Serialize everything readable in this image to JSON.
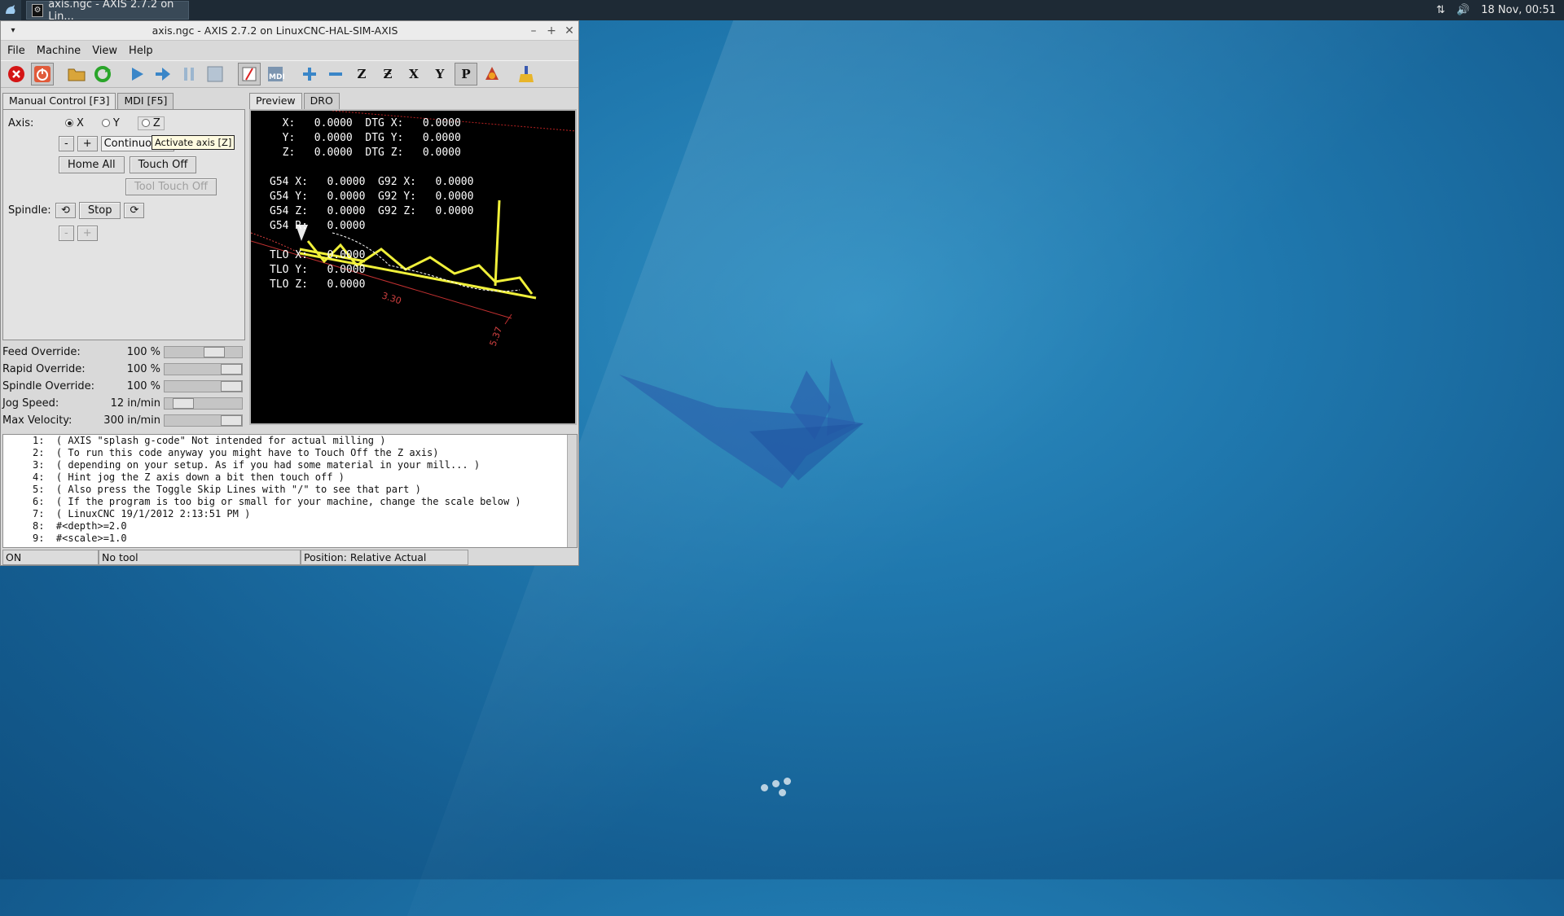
{
  "taskbar": {
    "task_title": "axis.ngc - AXIS 2.7.2 on Lin...",
    "clock": "18 Nov, 00:51"
  },
  "window": {
    "title": "axis.ngc - AXIS 2.7.2 on LinuxCNC-HAL-SIM-AXIS",
    "menu": [
      "File",
      "Machine",
      "View",
      "Help"
    ]
  },
  "toolbar_icons": [
    "estop-icon",
    "power-icon",
    "open-icon",
    "reload-icon",
    "run-icon",
    "step-icon",
    "pause-icon",
    "stop-icon",
    "skip-lines-icon",
    "mdi-icon",
    "zoom-in-icon",
    "zoom-out-icon",
    "view-z-icon",
    "view-z2-icon",
    "view-x-icon",
    "view-y-icon",
    "view-p-icon",
    "rotate-icon",
    "clear-live-plot-icon"
  ],
  "manual": {
    "tab_manual": "Manual Control [F3]",
    "tab_mdi": "MDI [F5]",
    "axis_label": "Axis:",
    "axis_x": "X",
    "axis_y": "Y",
    "axis_z": "Z",
    "minus": "-",
    "plus": "+",
    "jog_mode": "Continuous",
    "tooltip": "Activate axis [Z]",
    "home_all": "Home All",
    "touch_off": "Touch Off",
    "tool_touch_off": "Tool Touch Off",
    "spindle_label": "Spindle:",
    "spindle_stop": "Stop",
    "spindle_minus": "-",
    "spindle_plus": "+"
  },
  "overrides": [
    {
      "name": "Feed Override:",
      "value": "100 %",
      "fraction": 0.7
    },
    {
      "name": "Rapid Override:",
      "value": "100 %",
      "fraction": 1.0
    },
    {
      "name": "Spindle Override:",
      "value": "100 %",
      "fraction": 1.0
    },
    {
      "name": "Jog Speed:",
      "value": "12 in/min",
      "fraction": 0.15
    },
    {
      "name": "Max Velocity:",
      "value": "300 in/min",
      "fraction": 1.0
    }
  ],
  "preview": {
    "tab_preview": "Preview",
    "tab_dro": "DRO",
    "dro_lines": [
      "  X:   0.0000  DTG X:   0.0000",
      "  Y:   0.0000  DTG Y:   0.0000",
      "  Z:   0.0000  DTG Z:   0.0000",
      "",
      "G54 X:   0.0000  G92 X:   0.0000",
      "G54 Y:   0.0000  G92 Y:   0.0000",
      "G54 Z:   0.0000  G92 Z:   0.0000",
      "G54 R:   0.0000",
      "",
      "TLO X:   0.0000",
      "TLO Y:   0.0000",
      "TLO Z:   0.0000"
    ],
    "dim_a": "3.30",
    "dim_b": "5.37"
  },
  "gcode": [
    "1:  ( AXIS \"splash g-code\" Not intended for actual milling )",
    "2:  ( To run this code anyway you might have to Touch Off the Z axis)",
    "3:  ( depending on your setup. As if you had some material in your mill... )",
    "4:  ( Hint jog the Z axis down a bit then touch off )",
    "5:  ( Also press the Toggle Skip Lines with \"/\" to see that part )",
    "6:  ( If the program is too big or small for your machine, change the scale below )",
    "7:  ( LinuxCNC 19/1/2012 2:13:51 PM )",
    "8:  #<depth>=2.0",
    "9:  #<scale>=1.0"
  ],
  "status": {
    "state": "ON",
    "tool": "No tool",
    "position": "Position: Relative Actual"
  }
}
